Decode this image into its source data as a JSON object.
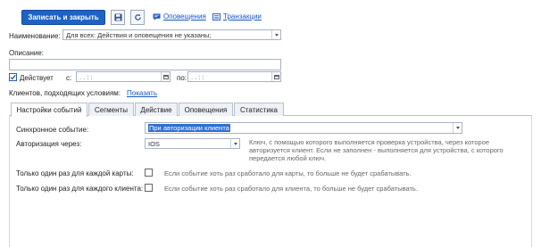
{
  "toolbar": {
    "save_close_label": "Записать и закрыть",
    "notifications_link": "Оповещения",
    "transactions_link": "Транзакции"
  },
  "form": {
    "name_label": "Наименование:",
    "name_value": "Для всех: Действия и оповещения не указаны;",
    "description_label": "Описание:",
    "description_value": "",
    "active_label": "Действует",
    "from_label": "с:",
    "to_label": "по:",
    "date_from_value": ". .   : :",
    "date_to_value": ". .   : :",
    "clients_label": "Клиентов, подходящих условиям:",
    "show_link": "Показать"
  },
  "tabs": [
    {
      "label": "Настройки событий",
      "active": true
    },
    {
      "label": "Сегменты",
      "active": false
    },
    {
      "label": "Действие",
      "active": false
    },
    {
      "label": "Оповещения",
      "active": false
    },
    {
      "label": "Статистика",
      "active": false
    }
  ],
  "settings": {
    "sync_event_label": "Синхронное событие:",
    "sync_event_value": "При авторизации клиента",
    "auth_via_label": "Авторизация через:",
    "auth_via_value": "IOS",
    "auth_hint": "Ключ, с помощью которого выполняется проверка устройства, через которое авторизуется клиент. Если не заполнен - выполняется для устройства, с которого передается любой ключ.",
    "once_card_label": "Только один раз для каждой карты:",
    "once_card_hint": "Если событие хоть раз сработало для карты, то больше не будет срабатывать.",
    "once_client_label": "Только один раз для каждого клиента:",
    "once_client_hint": "Если событие хоть раз сработало для клиента, то больше не будет срабатывать."
  },
  "colors": {
    "primary": "#1e63c4",
    "link": "#1a56c6",
    "selection": "#2f6fd1"
  }
}
